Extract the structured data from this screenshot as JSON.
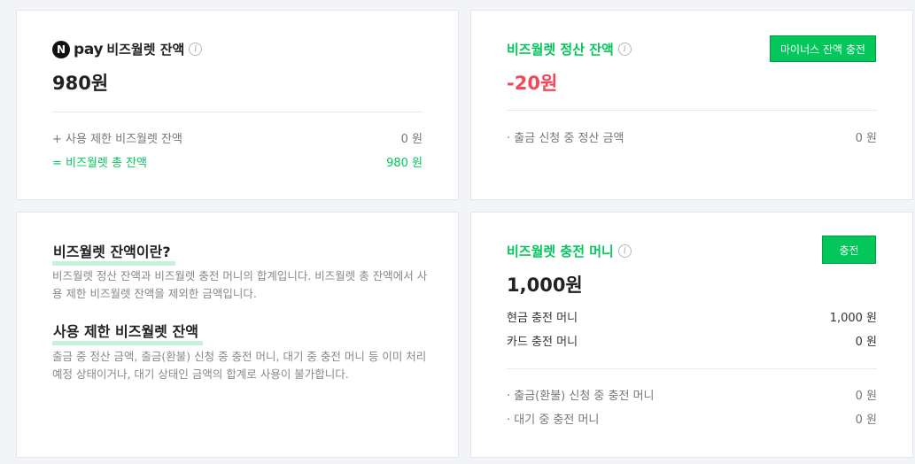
{
  "wallet_balance": {
    "brand_letter": "N",
    "brand_word": "pay",
    "title": "비즈월렛 잔액",
    "info_icon": "info-icon",
    "amount": "980원",
    "rows": [
      {
        "label": "+ 사용 제한 비즈월렛 잔액",
        "value": "0 원"
      },
      {
        "label": "= 비즈월렛 총 잔액",
        "value": "980 원"
      }
    ]
  },
  "settlement_balance": {
    "title": "비즈월렛 정산 잔액",
    "info_icon": "info-icon",
    "amount": "-20원",
    "button_label": "마이너스 잔액 충전",
    "rows": [
      {
        "label": "· 출금 신청 중 정산 금액",
        "value": "0 원"
      }
    ]
  },
  "help": {
    "title1": "비즈월렛 잔액이란?",
    "text1": "비즈월렛 정산 잔액과 비즈월렛 충전 머니의 합계입니다. 비즈월렛 총 잔액에서 사용 제한 비즈월렛 잔액을 제외한 금액입니다.",
    "title2": "사용 제한 비즈월렛 잔액",
    "text2": "출금 중 정산 금액, 출금(환불) 신청 중 충전 머니, 대기 중 충전 머니 등 이미 처리 예정 상태이거나, 대기 상태인 금액의 합계로 사용이 불가합니다."
  },
  "charge_money": {
    "title": "비즈월렛 충전 머니",
    "info_icon": "info-icon",
    "amount": "1,000원",
    "button_label": "충전",
    "rows": [
      {
        "label": "현금 충전 머니",
        "value": "1,000 원"
      },
      {
        "label": "카드 충전 머니",
        "value": "0 원"
      },
      {
        "label": "· 출금(환불) 신청 중 충전 머니",
        "value": "0 원"
      },
      {
        "label": "· 대기 중 충전 머니",
        "value": "0 원"
      }
    ]
  },
  "colors": {
    "accent_green": "#03c75a",
    "negative_red": "#f2485a",
    "highlight": "#c6f3d6"
  }
}
